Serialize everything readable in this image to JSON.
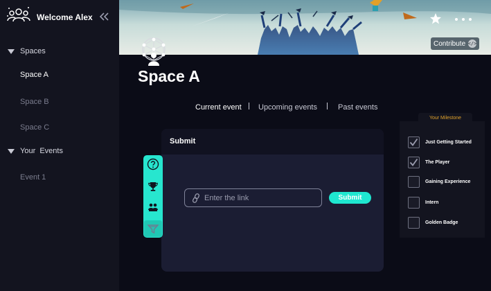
{
  "sidebar": {
    "title": "Welcome Alex",
    "sections": [
      {
        "label": "Spaces",
        "items": [
          "Space A",
          "Space B",
          "Space C"
        ]
      },
      {
        "label": "Your  Events",
        "items": [
          "Event 1"
        ]
      }
    ],
    "active_item": "Space A"
  },
  "banner": {
    "contribute_label": "Contribute",
    "contribute_icon": "</>"
  },
  "space": {
    "title": "Space A"
  },
  "tabs": [
    {
      "label": "Current event",
      "active": true
    },
    {
      "label": "Upcoming events",
      "active": false
    },
    {
      "label": "Past events",
      "active": false
    }
  ],
  "submit_card": {
    "title": "Submit",
    "input_placeholder": "Enter the link",
    "input_value": "",
    "button_label": "Submit"
  },
  "tools": [
    "help-icon",
    "trophy-icon",
    "team-icon",
    "funnel-icon"
  ],
  "milestone": {
    "title": "Your Milestone",
    "items": [
      {
        "label": "Just Getting Started",
        "checked": true
      },
      {
        "label": "The Player",
        "checked": true
      },
      {
        "label": "Gaining Experience",
        "checked": false
      },
      {
        "label": "Intern",
        "checked": false
      },
      {
        "label": "Golden Badge",
        "checked": false
      }
    ]
  },
  "colors": {
    "accent": "#1fe7d0",
    "milestone_title": "#e0a12b",
    "background": "#0b0c17",
    "sidebar": "#13141f",
    "card": "#1b1d33"
  }
}
